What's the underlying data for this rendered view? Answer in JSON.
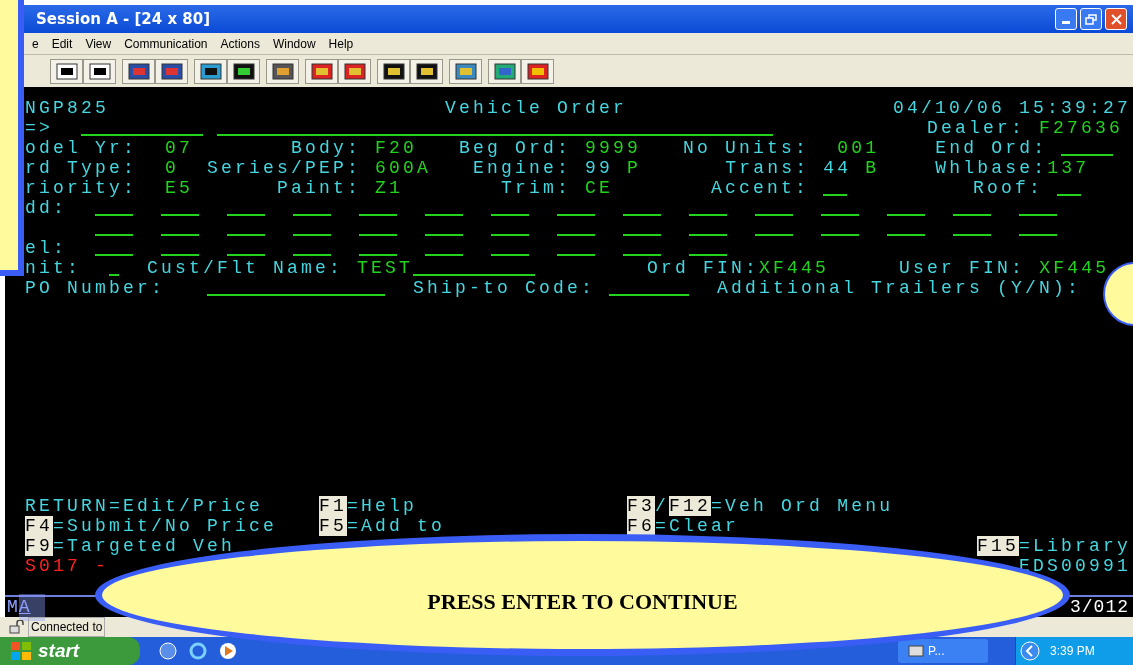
{
  "window": {
    "title": "Session A - [24 x 80]"
  },
  "menu": [
    "e",
    "Edit",
    "View",
    "Communication",
    "Actions",
    "Window",
    "Help"
  ],
  "terminal": {
    "top_lines": [
      {
        "segments": [
          {
            "kind": "label",
            "text": "NGP825"
          },
          {
            "kind": "label",
            "text": "Vehicle Order"
          },
          {
            "kind": "label",
            "text": "04/10/06 15:39:27"
          }
        ]
      },
      {
        "segments": [
          {
            "kind": "label",
            "text": "=>"
          },
          {
            "kind": "field"
          },
          {
            "kind": "field"
          },
          {
            "kind": "label",
            "text": "Dealer:"
          },
          {
            "kind": "value",
            "text": "F27636"
          }
        ]
      },
      {
        "segments": [
          {
            "kind": "label",
            "text": "odel Yr:"
          },
          {
            "kind": "value",
            "text": "07"
          },
          {
            "kind": "label",
            "text": "Body:"
          },
          {
            "kind": "value",
            "text": "F20"
          },
          {
            "kind": "label",
            "text": "Beg Ord:"
          },
          {
            "kind": "value",
            "text": "9999"
          },
          {
            "kind": "label",
            "text": "No Units:"
          },
          {
            "kind": "value",
            "text": "001"
          },
          {
            "kind": "label",
            "text": "End Ord:"
          },
          {
            "kind": "field"
          }
        ]
      },
      {
        "segments": [
          {
            "kind": "label",
            "text": "rd Type:"
          },
          {
            "kind": "value",
            "text": "0"
          },
          {
            "kind": "label",
            "text": "Series/PEP:"
          },
          {
            "kind": "value",
            "text": "600A"
          },
          {
            "kind": "label",
            "text": "Engine:"
          },
          {
            "kind": "label",
            "text": "99"
          },
          {
            "kind": "value",
            "text": "P"
          },
          {
            "kind": "label",
            "text": "Trans:"
          },
          {
            "kind": "label",
            "text": "44"
          },
          {
            "kind": "value",
            "text": "B"
          },
          {
            "kind": "label",
            "text": "Whlbase:"
          },
          {
            "kind": "value",
            "text": "137"
          }
        ]
      },
      {
        "segments": [
          {
            "kind": "label",
            "text": "riority:"
          },
          {
            "kind": "value",
            "text": "E5"
          },
          {
            "kind": "label",
            "text": "Paint:"
          },
          {
            "kind": "value",
            "text": "Z1"
          },
          {
            "kind": "label",
            "text": "Trim:"
          },
          {
            "kind": "value",
            "text": "CE"
          },
          {
            "kind": "label",
            "text": "Accent:"
          },
          {
            "kind": "field"
          },
          {
            "kind": "label",
            "text": "Roof:"
          },
          {
            "kind": "field"
          }
        ]
      },
      {
        "segments": [
          {
            "kind": "label",
            "text": "dd:"
          },
          {
            "kind": "field"
          },
          {
            "kind": "field"
          },
          {
            "kind": "field"
          },
          {
            "kind": "field"
          },
          {
            "kind": "field"
          },
          {
            "kind": "field"
          },
          {
            "kind": "field"
          },
          {
            "kind": "field"
          },
          {
            "kind": "field"
          },
          {
            "kind": "field"
          },
          {
            "kind": "field"
          },
          {
            "kind": "field"
          },
          {
            "kind": "field"
          },
          {
            "kind": "field"
          },
          {
            "kind": "field"
          }
        ]
      },
      {
        "segments": [
          {
            "kind": "field"
          },
          {
            "kind": "field"
          },
          {
            "kind": "field"
          },
          {
            "kind": "field"
          },
          {
            "kind": "field"
          },
          {
            "kind": "field"
          },
          {
            "kind": "field"
          },
          {
            "kind": "field"
          },
          {
            "kind": "field"
          },
          {
            "kind": "field"
          },
          {
            "kind": "field"
          },
          {
            "kind": "field"
          },
          {
            "kind": "field"
          },
          {
            "kind": "field"
          },
          {
            "kind": "field"
          }
        ]
      },
      {
        "segments": [
          {
            "kind": "label",
            "text": "el:"
          },
          {
            "kind": "field"
          },
          {
            "kind": "field"
          },
          {
            "kind": "field"
          },
          {
            "kind": "field"
          },
          {
            "kind": "field"
          },
          {
            "kind": "field"
          },
          {
            "kind": "field"
          },
          {
            "kind": "field"
          },
          {
            "kind": "field"
          },
          {
            "kind": "field"
          }
        ]
      },
      {
        "segments": [
          {
            "kind": "label",
            "text": "nit:"
          },
          {
            "kind": "field"
          },
          {
            "kind": "label",
            "text": "Cust/Flt Name:"
          },
          {
            "kind": "value",
            "text": "TEST"
          },
          {
            "kind": "field"
          },
          {
            "kind": "label",
            "text": "Ord FIN:"
          },
          {
            "kind": "value",
            "text": "XF445"
          },
          {
            "kind": "label",
            "text": "User FIN:"
          },
          {
            "kind": "value",
            "text": "XF445"
          }
        ]
      },
      {
        "segments": [
          {
            "kind": "label",
            "text": "PO Number:"
          },
          {
            "kind": "field"
          },
          {
            "kind": "label",
            "text": "Ship-to Code:"
          },
          {
            "kind": "field"
          },
          {
            "kind": "label",
            "text": "Additional Trailers (Y/N):"
          }
        ]
      }
    ],
    "bottom_lines": [
      {
        "segments": [
          {
            "kind": "label",
            "text": "RETURN=Edit/Price"
          },
          {
            "kind": "key",
            "text": "F1"
          },
          {
            "kind": "label",
            "text": "=Help"
          },
          {
            "kind": "key",
            "text": "F3"
          },
          {
            "kind": "label",
            "text": "/"
          },
          {
            "kind": "key",
            "text": "F12"
          },
          {
            "kind": "label",
            "text": "=Veh Ord Menu"
          }
        ]
      },
      {
        "segments": [
          {
            "kind": "key",
            "text": "F4"
          },
          {
            "kind": "label",
            "text": "=Submit/No Price"
          },
          {
            "kind": "key",
            "text": "F5"
          },
          {
            "kind": "label",
            "text": "=Add to"
          },
          {
            "kind": "key",
            "text": "F6"
          },
          {
            "kind": "label",
            "text": "=Clear"
          }
        ]
      },
      {
        "segments": [
          {
            "kind": "key",
            "text": "F9"
          },
          {
            "kind": "label",
            "text": "=Targeted Veh"
          },
          {
            "kind": "key",
            "text": "F15"
          },
          {
            "kind": "label",
            "text": "=Library"
          }
        ]
      },
      {
        "segments": [
          {
            "kind": "error",
            "text": "S017 -"
          },
          {
            "kind": "label",
            "text": "EDS00991"
          }
        ]
      }
    ],
    "oia": {
      "mode": "M",
      "cursor": "A",
      "position": "3/012"
    }
  },
  "status_bar": {
    "text": "Connected to"
  },
  "taskbar": {
    "start": "start",
    "task": "P...",
    "clock": "3:39 PM"
  },
  "callout": {
    "text": "PRESS ENTER TO CONTINUE"
  }
}
